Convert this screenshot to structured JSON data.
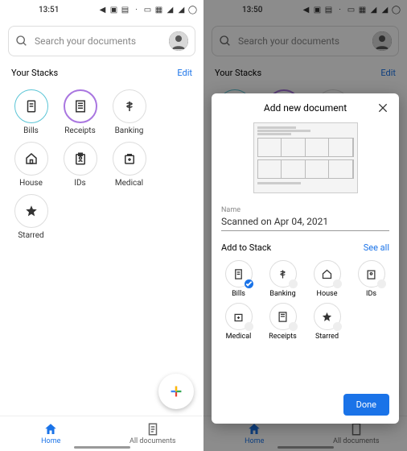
{
  "status": {
    "time_left": "13:51",
    "time_right": "13:50"
  },
  "search": {
    "placeholder": "Search your documents"
  },
  "section": {
    "title": "Your Stacks",
    "edit": "Edit"
  },
  "stacks": [
    {
      "label": "Bills"
    },
    {
      "label": "Receipts"
    },
    {
      "label": "Banking"
    },
    {
      "label": "House"
    },
    {
      "label": "IDs"
    },
    {
      "label": "Medical"
    },
    {
      "label": "Starred"
    }
  ],
  "nav": {
    "home": "Home",
    "all": "All documents"
  },
  "dialog": {
    "title": "Add new document",
    "name_label": "Name",
    "name_value": "Scanned on Apr 04, 2021",
    "add_to": "Add to Stack",
    "see_all": "See all",
    "done": "Done",
    "stacks": [
      {
        "label": "Bills"
      },
      {
        "label": "Banking"
      },
      {
        "label": "House"
      },
      {
        "label": "IDs"
      },
      {
        "label": "Medical"
      },
      {
        "label": "Receipts"
      },
      {
        "label": "Starred"
      }
    ]
  }
}
